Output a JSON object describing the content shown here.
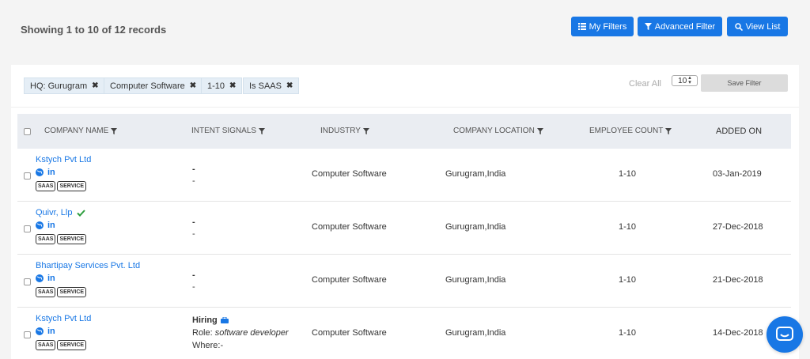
{
  "header": {
    "records_text": "Showing 1 to 10 of 12 records",
    "buttons": {
      "my_filters": "My Filters",
      "advanced_filter": "Advanced Filter",
      "view_list": "View List"
    }
  },
  "filters": {
    "chips": [
      "HQ: Gurugram",
      "Computer Software",
      "1-10",
      "Is SAAS"
    ],
    "clear_all": "Clear All",
    "page_size": "10",
    "save_filter": "Save Filter"
  },
  "table": {
    "columns": {
      "company_name": "COMPANY NAME",
      "intent_signals": "INTENT SIGNALS",
      "industry": "INDUSTRY",
      "company_location": "COMPANY LOCATION",
      "employee_count": "EMPLOYEE COUNT",
      "added_on": "ADDED ON"
    },
    "tags": [
      "SAAS",
      "SERVICE"
    ],
    "rows": [
      {
        "name": "Kstych Pvt Ltd",
        "verified": false,
        "intent_line1": "-",
        "intent_line2": "-",
        "industry": "Computer Software",
        "location": "Gurugram,India",
        "employees": "1-10",
        "added_on": "03-Jan-2019"
      },
      {
        "name": "Quivr, Llp",
        "verified": true,
        "intent_line1": "-",
        "intent_line2": "-",
        "industry": "Computer Software",
        "location": "Gurugram,India",
        "employees": "1-10",
        "added_on": "27-Dec-2018"
      },
      {
        "name": "Bhartipay Services Pvt. Ltd",
        "verified": false,
        "intent_line1": "-",
        "intent_line2": "-",
        "industry": "Computer Software",
        "location": "Gurugram,India",
        "employees": "1-10",
        "added_on": "21-Dec-2018"
      },
      {
        "name": "Kstych Pvt Ltd",
        "verified": false,
        "hiring_label": "Hiring",
        "role_label": "Role:",
        "role_value": "software developer",
        "where_label": "Where:-",
        "industry": "Computer Software",
        "location": "Gurugram,India",
        "employees": "1-10",
        "added_on": "14-Dec-2018"
      }
    ]
  },
  "colors": {
    "accent": "#1877e5",
    "verified": "#2e9e3e"
  }
}
